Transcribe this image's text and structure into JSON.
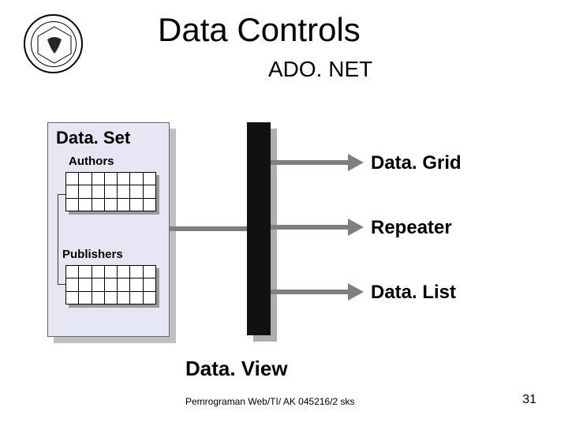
{
  "header": {
    "title": "Data Controls",
    "subtitle": "ADO. NET"
  },
  "dataset": {
    "title": "Data. Set",
    "tables": [
      "Authors",
      "Publishers"
    ]
  },
  "controls": [
    "Data. Grid",
    "Repeater",
    "Data. List"
  ],
  "dataview_label": "Data. View",
  "footer": {
    "course": "Pemrograman Web/TI/ AK 045216/2 sks",
    "page": "31"
  },
  "logo": {
    "name": "university-seal"
  }
}
